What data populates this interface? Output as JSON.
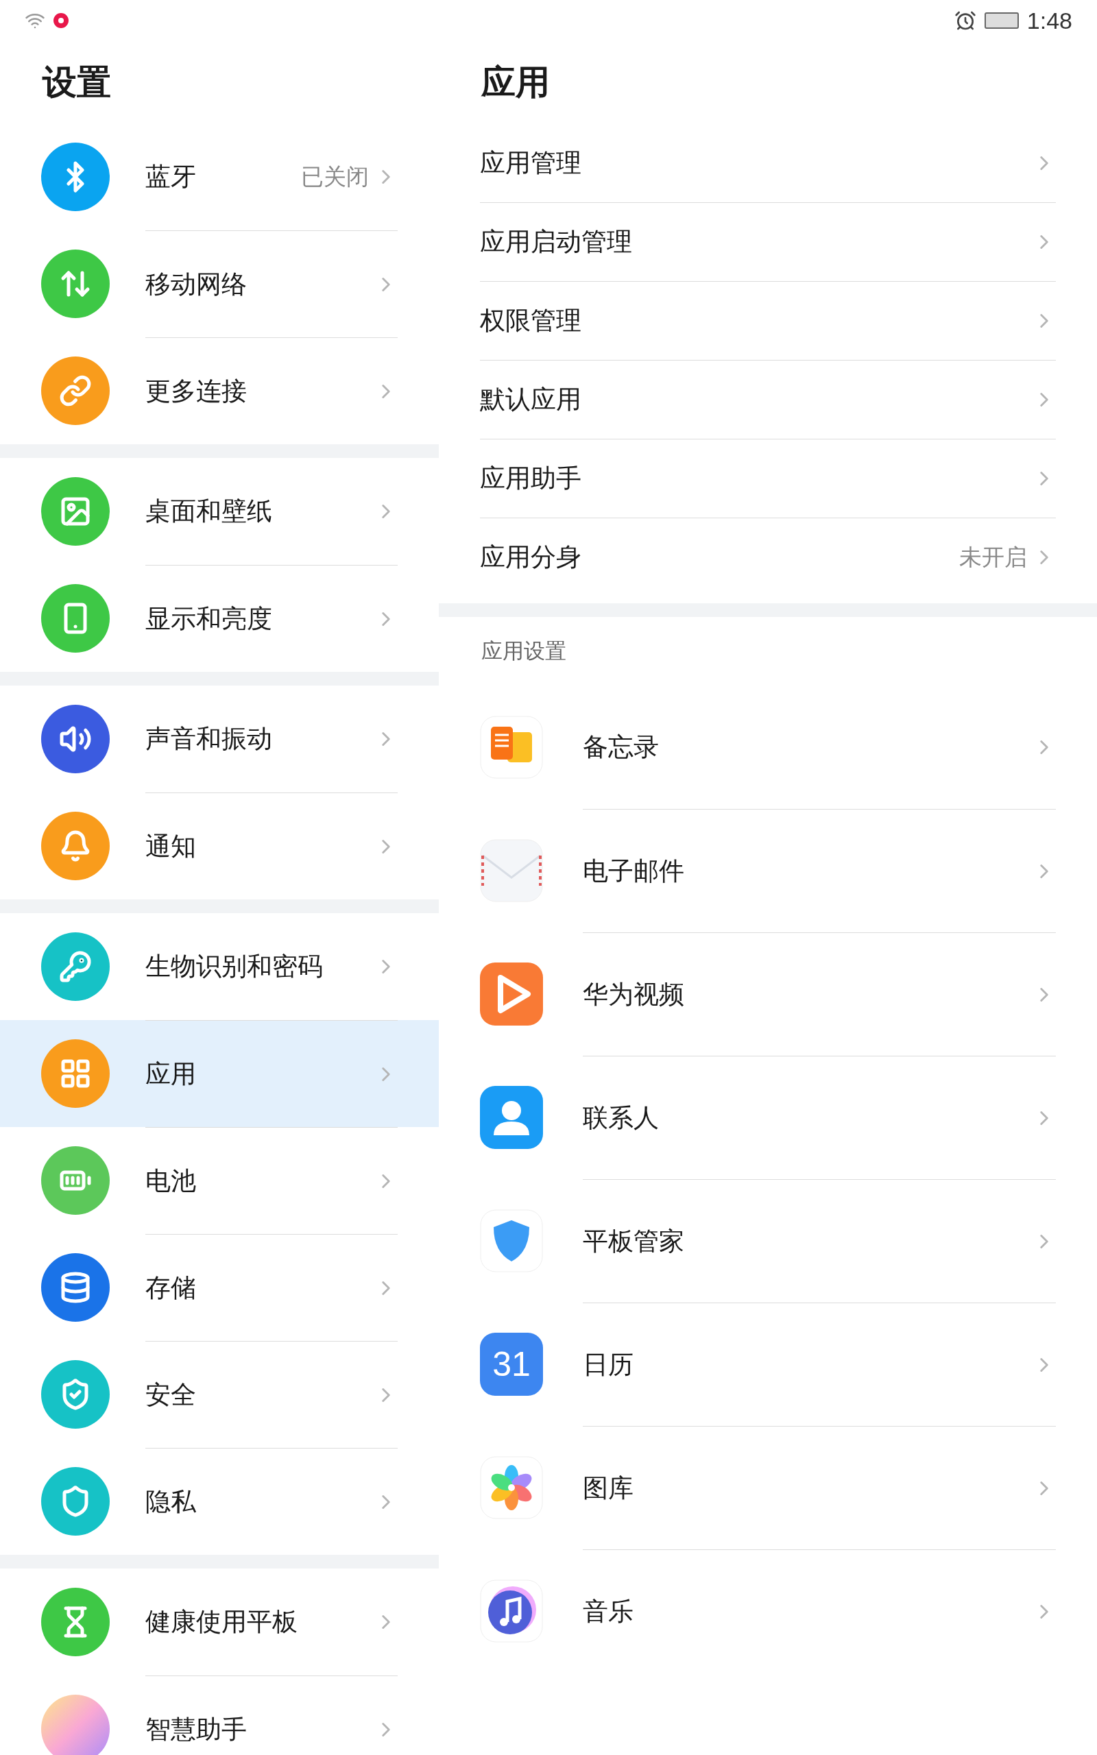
{
  "status_bar": {
    "time": "1:48"
  },
  "sidebar": {
    "title": "设置",
    "groups": [
      {
        "items": [
          {
            "label": "蓝牙",
            "value": "已关闭",
            "selected": false
          },
          {
            "label": "移动网络",
            "selected": false
          },
          {
            "label": "更多连接",
            "selected": false
          }
        ]
      },
      {
        "items": [
          {
            "label": "桌面和壁纸",
            "selected": false
          },
          {
            "label": "显示和亮度",
            "selected": false
          }
        ]
      },
      {
        "items": [
          {
            "label": "声音和振动",
            "selected": false
          },
          {
            "label": "通知",
            "selected": false
          }
        ]
      },
      {
        "items": [
          {
            "label": "生物识别和密码",
            "selected": false
          },
          {
            "label": "应用",
            "selected": true
          },
          {
            "label": "电池",
            "selected": false
          },
          {
            "label": "存储",
            "selected": false
          },
          {
            "label": "安全",
            "selected": false
          },
          {
            "label": "隐私",
            "selected": false
          }
        ]
      },
      {
        "items": [
          {
            "label": "健康使用平板",
            "selected": false
          },
          {
            "label": "智慧助手",
            "selected": false
          }
        ]
      }
    ]
  },
  "detail": {
    "title": "应用",
    "items": [
      {
        "label": "应用管理"
      },
      {
        "label": "应用启动管理"
      },
      {
        "label": "权限管理"
      },
      {
        "label": "默认应用"
      },
      {
        "label": "应用助手"
      },
      {
        "label": "应用分身",
        "value": "未开启"
      }
    ],
    "section_label": "应用设置",
    "apps": [
      {
        "label": "备忘录"
      },
      {
        "label": "电子邮件"
      },
      {
        "label": "华为视频"
      },
      {
        "label": "联系人"
      },
      {
        "label": "平板管家"
      },
      {
        "label": "日历",
        "icon_text": "31"
      },
      {
        "label": "图库"
      },
      {
        "label": "音乐"
      }
    ]
  }
}
